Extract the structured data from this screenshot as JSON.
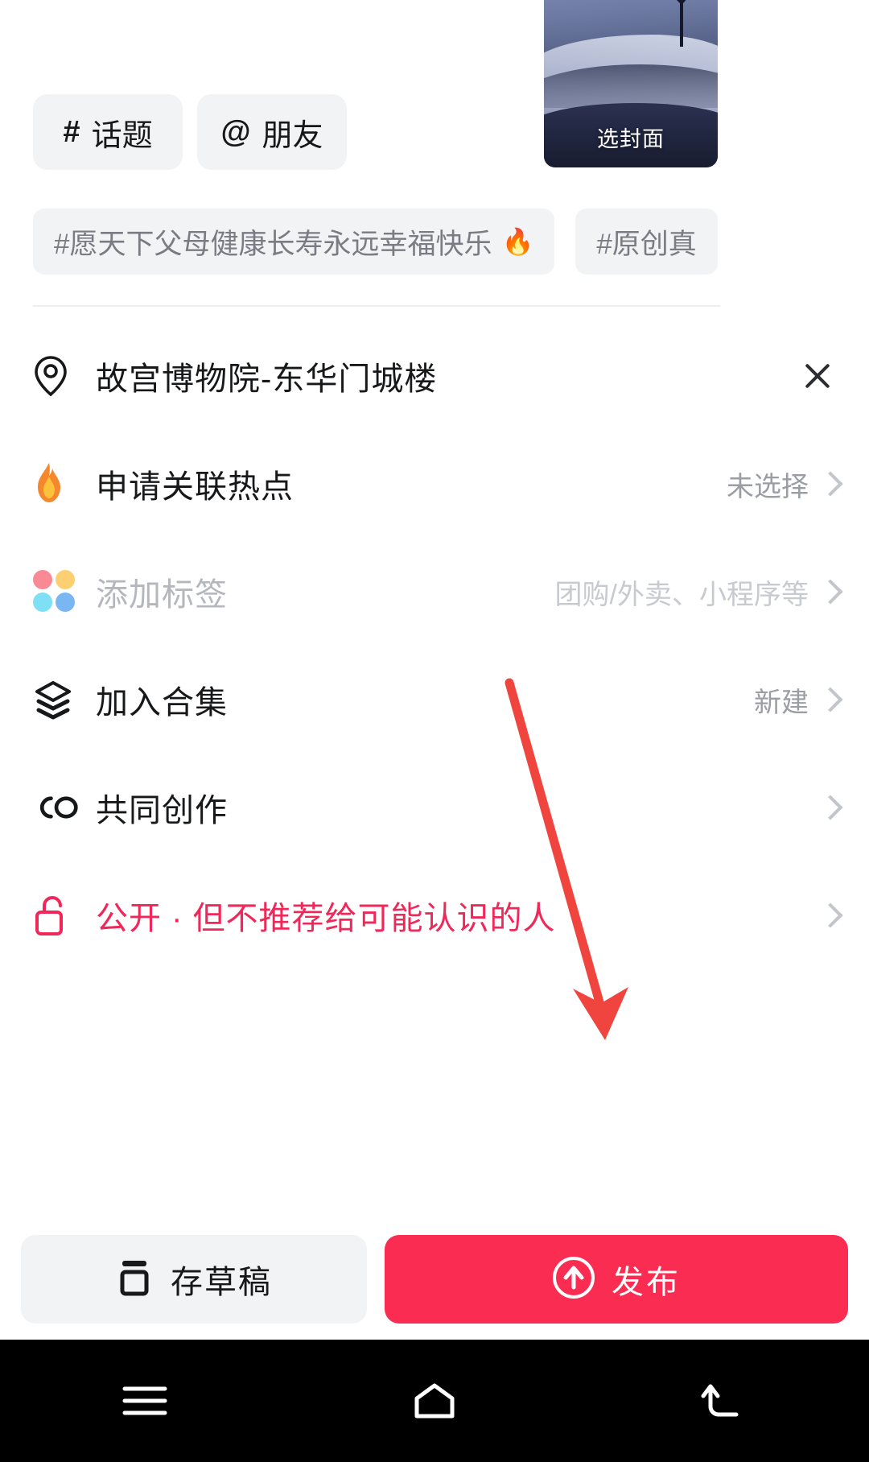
{
  "cover": {
    "label": "选封面",
    "icon": "cover-thumbnail"
  },
  "quick_actions": [
    {
      "glyph": "#",
      "label": "话题",
      "name": "topic"
    },
    {
      "glyph": "@",
      "label": "朋友",
      "name": "friend"
    }
  ],
  "suggested_tags": [
    {
      "text": "#愿天下父母健康长寿永远幸福快乐",
      "hot": true,
      "hot_icon": "🔥"
    },
    {
      "text": "#原创真",
      "hot": false,
      "hot_icon": ""
    }
  ],
  "options": [
    {
      "name": "location",
      "icon": "location-pin-icon",
      "label": "故宫博物院-东华门城楼",
      "value": "",
      "trailing": "close-icon",
      "style": "normal"
    },
    {
      "name": "hotspot",
      "icon": "flame-icon",
      "label": "申请关联热点",
      "value": "未选择",
      "trailing": "chevron-right-icon",
      "style": "normal"
    },
    {
      "name": "add-tag",
      "icon": "four-dots-icon",
      "label": "添加标签",
      "value": "团购/外卖、小程序等",
      "trailing": "chevron-right-icon",
      "style": "muted"
    },
    {
      "name": "join-collection",
      "icon": "layers-icon",
      "label": "加入合集",
      "value": "新建",
      "trailing": "chevron-right-icon",
      "style": "normal"
    },
    {
      "name": "co-creation",
      "icon": "co-icon",
      "label": "共同创作",
      "value": "",
      "trailing": "chevron-right-icon",
      "style": "normal"
    },
    {
      "name": "privacy",
      "icon": "unlock-icon",
      "label": "公开 · 但不推荐给可能认识的人",
      "value": "",
      "trailing": "chevron-right-icon",
      "style": "accent"
    }
  ],
  "bottom": {
    "draft_label": "存草稿",
    "draft_icon": "save-draft-icon",
    "publish_label": "发布",
    "publish_icon": "upload-arrow-icon"
  },
  "navbar": {
    "menu_icon": "menu-icon",
    "home_icon": "home-icon",
    "back_icon": "back-icon"
  },
  "colors": {
    "publish_bg": "#fb2c51",
    "accent": "#f0285a",
    "chip_bg": "#f2f3f5",
    "annotation_arrow": "#f0453f"
  }
}
